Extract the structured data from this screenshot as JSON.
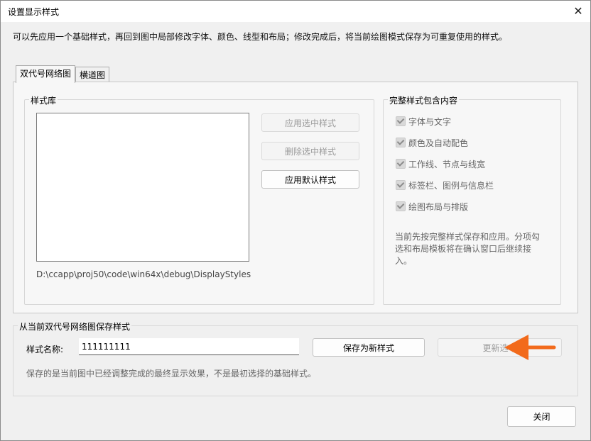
{
  "window": {
    "title": "设置显示样式",
    "close_label": "✕"
  },
  "description": "可以先应用一个基础样式，再回到图中局部修改字体、颜色、线型和布局；修改完成后，将当前绘图模式保存为可重复使用的样式。",
  "tabs": [
    {
      "label": "双代号网络图",
      "active": true
    },
    {
      "label": "横道图",
      "active": false
    }
  ],
  "style_library": {
    "label": "样式库",
    "path": "D:\\ccapp\\proj50\\code\\win64x\\debug\\DisplayStyles",
    "buttons": {
      "apply_selected": "应用选中样式",
      "delete_selected": "删除选中样式",
      "apply_default": "应用默认样式"
    }
  },
  "full_style": {
    "label": "完整样式包含内容",
    "items": [
      "字体与文字",
      "颜色及自动配色",
      "工作线、节点与线宽",
      "标签栏、图例与信息栏",
      "绘图布局与排版"
    ],
    "note": "当前先按完整样式保存和应用。分项勾选和布局模板将在确认窗口后继续接入。"
  },
  "save": {
    "label": "从当前双代号网络图保存样式",
    "name_label": "样式名称:",
    "name_value": "111111111",
    "save_new": "保存为新样式",
    "update_selected": "更新选中",
    "hint": "保存的是当前图中已经调整完成的最终显示效果，不是最初选择的基础样式。"
  },
  "footer": {
    "close_button": "关闭"
  },
  "colors": {
    "arrow": "#f26a1b"
  }
}
